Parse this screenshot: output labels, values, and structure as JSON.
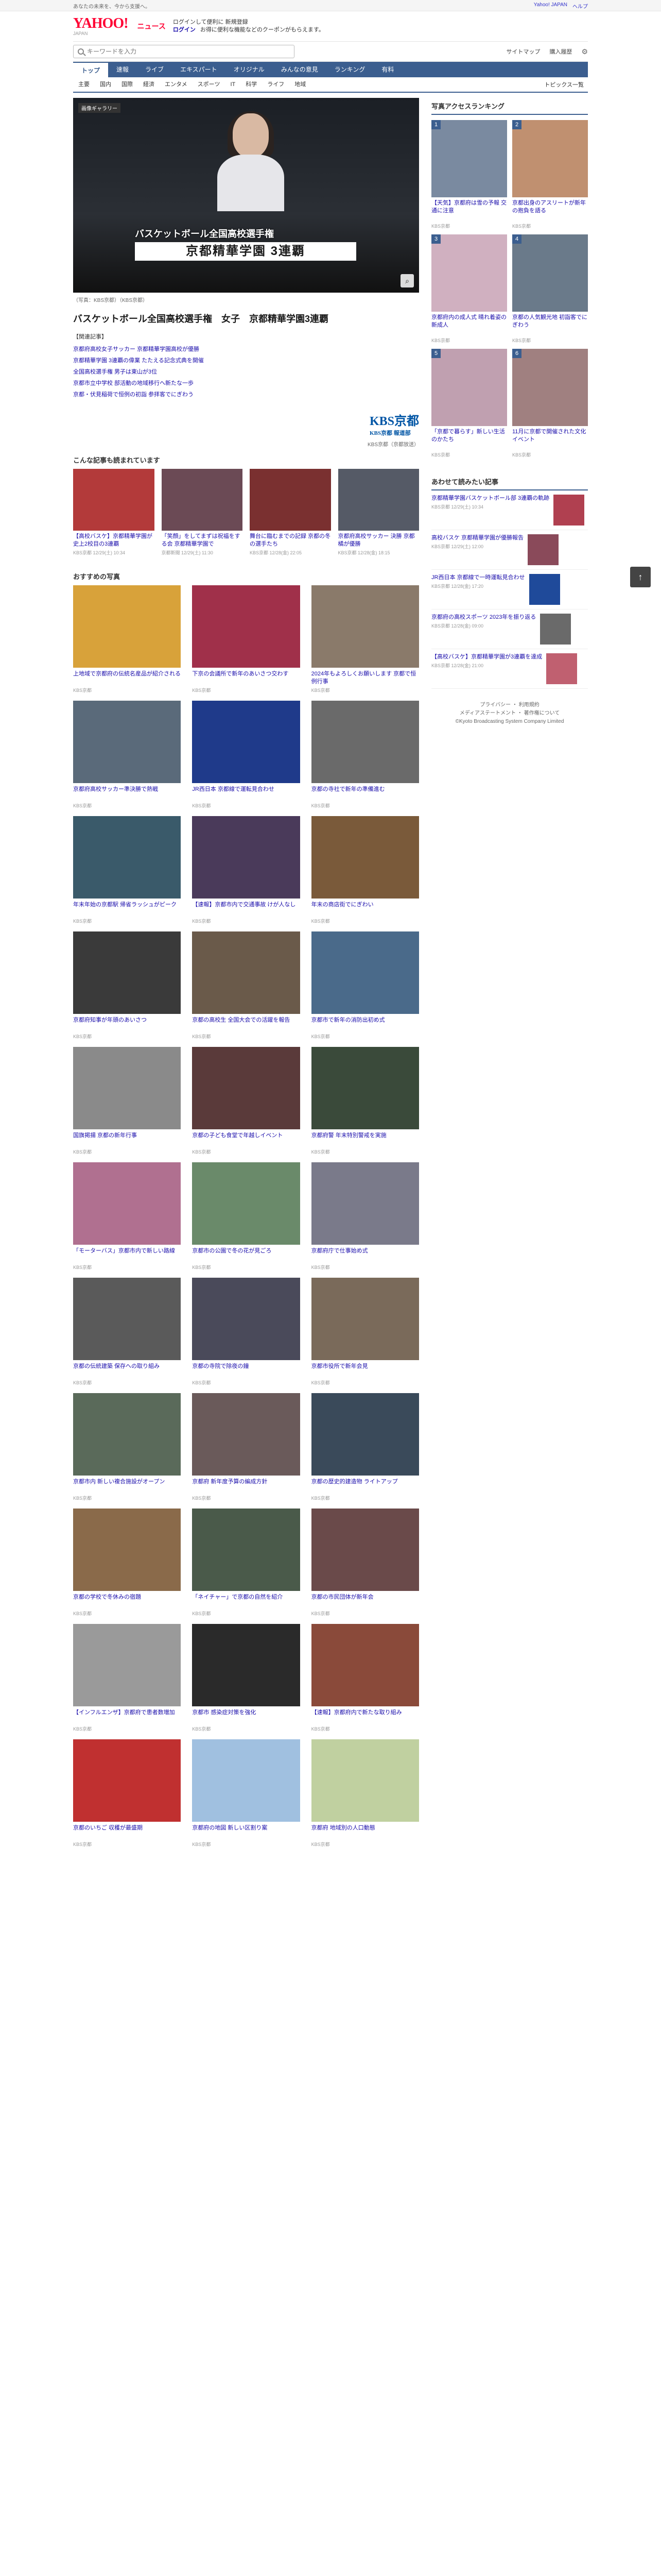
{
  "top_strip": {
    "left_text": "あなたの未来を、今から支援へ。",
    "links": [
      "Yahoo! JAPAN",
      "ヘルプ"
    ]
  },
  "header": {
    "logo_main": "YAHOO!",
    "logo_sub": "JAPAN",
    "service": "ニュース",
    "promo_line1": "ログインして便利に 新規登録",
    "promo_login": "ログイン",
    "promo_line2": "お得に便利な機能などのクーポンがもらえます。"
  },
  "search": {
    "placeholder": "キーワードを入力",
    "right_items": [
      "サイトマップ",
      "購入履歴"
    ]
  },
  "main_nav": [
    "トップ",
    "速報",
    "ライブ",
    "エキスパート",
    "オリジナル",
    "みんなの意見",
    "ランキング",
    "有料"
  ],
  "sub_nav": {
    "items": [
      "主要",
      "国内",
      "国際",
      "経済",
      "エンタメ",
      "スポーツ",
      "IT",
      "科学",
      "ライフ",
      "地域"
    ],
    "topics_link": "トピックス一覧"
  },
  "hero": {
    "badge": "画像ギャラリー",
    "caption_top": "バスケットボール全国高校選手権",
    "caption_main": "京都精華学園 3連覇",
    "photo_credit": "（写真：KBS京都）（KBS京都）"
  },
  "article": {
    "headline": "バスケットボール全国高校選手権　女子　京都精華学園3連覇",
    "related_title": "【関連記事】",
    "related": [
      "京都府高校女子サッカー 京都精華学園高校が優勝",
      "京都精華学園 3連覇の偉業 たたえる記念式典を開催",
      "全国高校選手権 男子は東山が3位",
      "京都市立中学校 部活動の地域移行へ新たな一歩",
      "京都・伏見稲荷で恒例の初詣 参拝客でにぎわう"
    ],
    "kbs_logo": "KBS京都",
    "kbs_sub": "KBS京都 報道部",
    "sources": "KBS京都（京都放送）"
  },
  "more_articles": {
    "title": "こんな記事も読まれています",
    "items": [
      {
        "title": "【高校バスケ】京都精華学園が史上2校目の3連覇",
        "meta": "KBS京都 12/29(土) 10:34"
      },
      {
        "title": "「笑顔」をしてまずは祝福をする会 京都精華学園で",
        "meta": "京都新聞 12/29(土) 11:30"
      },
      {
        "title": "舞台に臨むまでの記録 京都の冬の選手たち",
        "meta": "KBS京都 12/28(金) 22:05"
      },
      {
        "title": "京都府高校サッカー 決勝 京都橘が優勝",
        "meta": "KBS京都 12/28(金) 18:15"
      }
    ]
  },
  "photos": {
    "title": "おすすめの写真",
    "items": [
      {
        "title": "上地域で京都府の伝統名産品が紹介される",
        "meta": "KBS京都"
      },
      {
        "title": "下京の会議所で新年のあいさつ交わす",
        "meta": "KBS京都"
      },
      {
        "title": "2024年もよろしくお願いします 京都で恒例行事",
        "meta": "KBS京都"
      },
      {
        "title": "京都府高校サッカー準決勝で熱戦",
        "meta": "KBS京都"
      },
      {
        "title": "JR西日本 京都線で運転見合わせ",
        "meta": "KBS京都"
      },
      {
        "title": "京都の寺社で新年の準備進む",
        "meta": "KBS京都"
      },
      {
        "title": "年末年始の京都駅 帰省ラッシュがピーク",
        "meta": "KBS京都"
      },
      {
        "title": "【速報】京都市内で交通事故 けが人なし",
        "meta": "KBS京都"
      },
      {
        "title": "年末の商店街でにぎわい",
        "meta": "KBS京都"
      },
      {
        "title": "京都府知事が年頭のあいさつ",
        "meta": "KBS京都"
      },
      {
        "title": "京都の高校生 全国大会での活躍を報告",
        "meta": "KBS京都"
      },
      {
        "title": "京都市で新年の消防出初め式",
        "meta": "KBS京都"
      },
      {
        "title": "国旗掲揚 京都の新年行事",
        "meta": "KBS京都"
      },
      {
        "title": "京都の子ども食堂で年越しイベント",
        "meta": "KBS京都"
      },
      {
        "title": "京都府警 年末特別警戒を実施",
        "meta": "KBS京都"
      },
      {
        "title": "「モーターバス」京都市内で新しい路線",
        "meta": "KBS京都"
      },
      {
        "title": "京都市の公園で冬の花が見ごろ",
        "meta": "KBS京都"
      },
      {
        "title": "京都府庁で仕事始め式",
        "meta": "KBS京都"
      },
      {
        "title": "京都の伝統建築 保存への取り組み",
        "meta": "KBS京都"
      },
      {
        "title": "京都の寺院で除夜の鐘",
        "meta": "KBS京都"
      },
      {
        "title": "京都市役所で新年会見",
        "meta": "KBS京都"
      },
      {
        "title": "京都市内 新しい複合施設がオープン",
        "meta": "KBS京都"
      },
      {
        "title": "京都府 新年度予算の編成方針",
        "meta": "KBS京都"
      },
      {
        "title": "京都の歴史的建造物 ライトアップ",
        "meta": "KBS京都"
      },
      {
        "title": "京都の学校で冬休みの宿題",
        "meta": "KBS京都"
      },
      {
        "title": "「ネイチャー」で京都の自然を紹介",
        "meta": "KBS京都"
      },
      {
        "title": "京都の市民団体が新年会",
        "meta": "KBS京都"
      },
      {
        "title": "【インフルエンザ】京都府で患者数増加",
        "meta": "KBS京都"
      },
      {
        "title": "京都市 感染症対策を強化",
        "meta": "KBS京都"
      },
      {
        "title": "【速報】京都府内で新たな取り組み",
        "meta": "KBS京都"
      },
      {
        "title": "京都のいちご 収穫が最盛期",
        "meta": "KBS京都"
      },
      {
        "title": "京都府の地図 新しい区割り案",
        "meta": "KBS京都"
      },
      {
        "title": "京都府 地域別の人口動態",
        "meta": "KBS京都"
      }
    ]
  },
  "ranking": {
    "title": "写真アクセスランキング",
    "items": [
      {
        "title": "【天気】京都府は雪の予報 交通に注意",
        "meta": "KBS京都"
      },
      {
        "title": "京都出身のアスリートが新年の抱負を語る",
        "meta": "KBS京都"
      },
      {
        "title": "京都府内の成人式 晴れ着姿の新成人",
        "meta": "KBS京都"
      },
      {
        "title": "京都の人気観光地 初詣客でにぎわう",
        "meta": "KBS京都"
      },
      {
        "title": "「京都で暮らす」新しい生活のかたち",
        "meta": "KBS京都"
      },
      {
        "title": "11月に京都で開催された文化イベント",
        "meta": "KBS京都"
      }
    ]
  },
  "side_news": {
    "title": "あわせて読みたい記事",
    "items": [
      {
        "text": "京都精華学園バスケットボール部 3連覇の軌跡",
        "meta": "KBS京都 12/29(土) 10:34"
      },
      {
        "text": "高校バスケ 京都精華学園が優勝報告",
        "meta": "KBS京都 12/29(土) 12:00"
      },
      {
        "text": "JR西日本 京都線で一時運転見合わせ",
        "meta": "KBS京都 12/28(金) 17:20"
      },
      {
        "text": "京都府の高校スポーツ 2023年を振り返る",
        "meta": "KBS京都 12/28(金) 09:00"
      },
      {
        "text": "【高校バスケ】京都精華学園が3連覇を達成",
        "meta": "KBS京都 12/28(金) 21:00"
      }
    ]
  },
  "footer": {
    "lines": [
      "プライバシー ・ 利用規約",
      "メディアステートメント ・ 著作権について",
      "©Kyoto Broadcasting System Company Limited"
    ]
  },
  "to_top": "↑"
}
